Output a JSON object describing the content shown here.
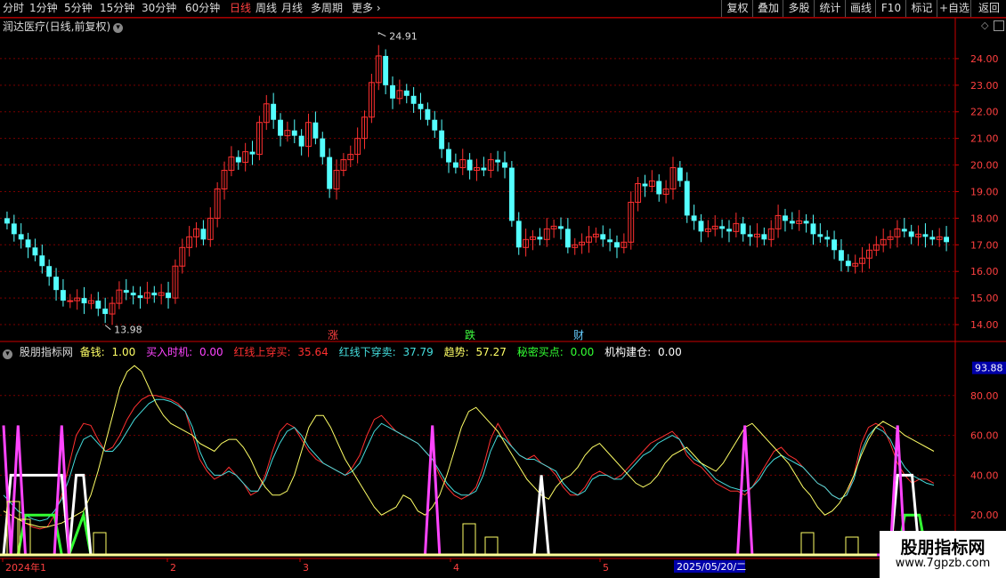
{
  "toolbar": {
    "periods": [
      "分时",
      "1分钟",
      "5分钟",
      "15分钟",
      "30分钟",
      "60分钟",
      "日线",
      "周线",
      "月线",
      "多周期",
      "更多"
    ],
    "active_period": "日线",
    "more_chevron": "›",
    "buttons": [
      "复权",
      "叠加",
      "多股",
      "统计",
      "画线",
      "F10",
      "标记",
      "+自选",
      "返回"
    ]
  },
  "main_chart": {
    "title": "润达医疗(日线,前复权)",
    "high_label": "24.91",
    "low_label": "13.98",
    "markers": [
      {
        "text": "涨",
        "color": "#ff4040"
      },
      {
        "text": "跌",
        "color": "#40ff40"
      },
      {
        "text": "财",
        "color": "#66ccff"
      }
    ]
  },
  "indicator": {
    "name": "股朋指标网",
    "items": [
      {
        "label": "备钱:",
        "value": "1.00",
        "color": "#ffff66"
      },
      {
        "label": "买入时机:",
        "value": "0.00",
        "color": "#ff44ff"
      },
      {
        "label": "红线上穿买:",
        "value": "35.64",
        "color": "#ff3030"
      },
      {
        "label": "红线下穿卖:",
        "value": "37.79",
        "color": "#44dddd"
      },
      {
        "label": "趋势:",
        "value": "57.27",
        "color": "#ffff66"
      },
      {
        "label": "秘密买点:",
        "value": "0.00",
        "color": "#33ff33"
      },
      {
        "label": "机构建仓:",
        "value": "0.00",
        "color": "#ffffff"
      }
    ],
    "current_value_tag": "93.88"
  },
  "timeline": {
    "labels": [
      "2024年1",
      "2",
      "3",
      "4",
      "5"
    ],
    "cursor_date": "2025/05/20/二"
  },
  "brand": {
    "title": "股朋指标网",
    "url": "www.7gpzb.com"
  },
  "colors": {
    "up": "#ff3030",
    "down": "#54ffff",
    "grid": "#7a0000",
    "axis": "#cc0000"
  },
  "chart_data": [
    {
      "type": "candlestick",
      "title": "润达医疗(日线,前复权)",
      "ylim": [
        13.5,
        25.0
      ],
      "y_ticks": [
        14.0,
        15.0,
        16.0,
        17.0,
        18.0,
        19.0,
        20.0,
        21.0,
        22.0,
        23.0,
        24.0
      ],
      "high": 24.91,
      "low": 13.98,
      "close": [
        17.8,
        17.4,
        17.2,
        16.9,
        16.6,
        16.2,
        15.8,
        15.3,
        14.9,
        14.9,
        15.0,
        14.8,
        14.9,
        14.6,
        14.4,
        14.8,
        15.3,
        15.2,
        15.1,
        15.0,
        15.2,
        15.1,
        15.2,
        15.0,
        16.2,
        16.9,
        17.3,
        17.6,
        17.2,
        18.0,
        19.1,
        19.8,
        20.3,
        20.1,
        20.5,
        20.4,
        21.6,
        22.3,
        21.7,
        21.1,
        21.3,
        21.1,
        20.7,
        21.6,
        21.0,
        20.3,
        19.1,
        19.8,
        20.2,
        20.4,
        21.0,
        21.8,
        23.1,
        24.1,
        23.0,
        22.5,
        22.8,
        22.6,
        22.3,
        22.1,
        21.7,
        21.3,
        20.6,
        20.1,
        19.9,
        20.2,
        19.8,
        19.9,
        19.8,
        20.2,
        20.1,
        19.9,
        17.9,
        16.9,
        17.2,
        17.3,
        17.2,
        17.6,
        17.7,
        17.6,
        16.9,
        17.0,
        17.1,
        17.3,
        17.4,
        17.2,
        17.1,
        16.9,
        17.1,
        18.6,
        19.3,
        19.2,
        19.4,
        18.9,
        19.1,
        19.9,
        19.4,
        18.1,
        17.9,
        17.5,
        17.6,
        17.7,
        17.6,
        17.5,
        17.8,
        17.4,
        17.3,
        17.4,
        17.2,
        17.6,
        18.1,
        17.9,
        17.8,
        17.9,
        17.8,
        17.4,
        17.3,
        17.2,
        16.8,
        16.4,
        16.2,
        16.3,
        16.5,
        16.8,
        17.0,
        17.2,
        17.3,
        17.6,
        17.5,
        17.3,
        17.4,
        17.3,
        17.2,
        17.3,
        17.1
      ],
      "volume_markers": [
        "涨",
        "跌",
        "财"
      ]
    },
    {
      "type": "line",
      "title": "股朋指标网",
      "ylim": [
        0,
        100
      ],
      "y_ticks": [
        20,
        40,
        60,
        80
      ],
      "series": [
        {
          "name": "红线上穿买",
          "color": "#ff3030",
          "values": [
            22,
            20,
            18,
            16,
            14,
            13,
            14,
            20,
            30,
            45,
            60,
            66,
            65,
            58,
            52,
            54,
            60,
            68,
            74,
            78,
            80,
            80,
            79,
            78,
            76,
            72,
            60,
            48,
            42,
            38,
            40,
            44,
            40,
            36,
            30,
            32,
            40,
            52,
            62,
            66,
            64,
            58,
            52,
            48,
            46,
            44,
            42,
            40,
            44,
            50,
            60,
            68,
            70,
            66,
            62,
            60,
            58,
            56,
            52,
            48,
            40,
            34,
            30,
            28,
            30,
            34,
            44,
            58,
            66,
            60,
            54,
            50,
            48,
            50,
            46,
            44,
            40,
            34,
            30,
            30,
            34,
            40,
            42,
            40,
            38,
            40,
            44,
            48,
            52,
            56,
            58,
            60,
            62,
            58,
            50,
            46,
            44,
            40,
            36,
            34,
            32,
            32,
            30,
            34,
            40,
            46,
            52,
            54,
            50,
            48,
            44,
            40,
            36,
            34,
            30,
            28,
            30,
            40,
            56,
            64,
            66,
            64,
            56,
            46,
            40,
            36,
            38,
            38,
            36
          ]
        },
        {
          "name": "红线下穿卖",
          "color": "#44dddd",
          "values": [
            30,
            26,
            22,
            20,
            18,
            17,
            18,
            22,
            28,
            38,
            50,
            58,
            60,
            56,
            52,
            52,
            56,
            62,
            68,
            72,
            76,
            78,
            78,
            77,
            75,
            72,
            64,
            52,
            44,
            40,
            40,
            42,
            40,
            36,
            32,
            32,
            38,
            48,
            56,
            62,
            64,
            60,
            54,
            50,
            46,
            44,
            42,
            40,
            42,
            46,
            54,
            62,
            66,
            64,
            62,
            60,
            58,
            56,
            52,
            48,
            42,
            36,
            32,
            30,
            30,
            32,
            40,
            52,
            60,
            58,
            54,
            50,
            48,
            48,
            46,
            44,
            42,
            36,
            32,
            30,
            32,
            38,
            40,
            40,
            38,
            38,
            42,
            46,
            50,
            52,
            56,
            58,
            60,
            58,
            52,
            48,
            46,
            42,
            38,
            36,
            34,
            33,
            32,
            34,
            38,
            44,
            48,
            50,
            48,
            46,
            44,
            40,
            36,
            34,
            30,
            28,
            30,
            38,
            52,
            60,
            64,
            62,
            58,
            50,
            44,
            40,
            38,
            36,
            35
          ]
        },
        {
          "name": "趋势",
          "color": "#ffff66",
          "values": [
            22,
            20,
            18,
            16,
            15,
            14,
            14,
            15,
            16,
            18,
            20,
            22,
            30,
            42,
            56,
            70,
            84,
            92,
            95,
            92,
            84,
            76,
            70,
            66,
            64,
            62,
            60,
            56,
            54,
            52,
            56,
            58,
            58,
            54,
            48,
            40,
            34,
            30,
            30,
            32,
            40,
            52,
            64,
            70,
            70,
            64,
            56,
            48,
            42,
            36,
            30,
            24,
            20,
            22,
            24,
            30,
            28,
            22,
            20,
            24,
            30,
            40,
            52,
            64,
            72,
            74,
            70,
            66,
            62,
            56,
            50,
            44,
            38,
            34,
            30,
            28,
            34,
            38,
            40,
            44,
            50,
            54,
            56,
            52,
            48,
            44,
            40,
            36,
            34,
            36,
            40,
            46,
            50,
            52,
            54,
            50,
            46,
            44,
            42,
            46,
            52,
            58,
            64,
            66,
            62,
            58,
            54,
            50,
            46,
            40,
            34,
            30,
            24,
            20,
            22,
            26,
            32,
            40,
            50,
            58,
            64,
            67,
            65,
            63,
            60,
            58,
            56,
            54,
            52
          ]
        },
        {
          "name": "秘密买点",
          "color": "#33ff33",
          "values": [
            0,
            0,
            0,
            20,
            20,
            20,
            20,
            20,
            0,
            0,
            10,
            20,
            0,
            0,
            0,
            0,
            0,
            0,
            0,
            0,
            0,
            0,
            0,
            0,
            0,
            0,
            0,
            0,
            0,
            0,
            0,
            0,
            0,
            0,
            0,
            0,
            0,
            0,
            0,
            0,
            0,
            0,
            0,
            0,
            0,
            0,
            0,
            0,
            0,
            0,
            0,
            0,
            0,
            0,
            0,
            0,
            0,
            0,
            0,
            0,
            0,
            0,
            0,
            0,
            0,
            0,
            0,
            0,
            0,
            0,
            0,
            0,
            0,
            0,
            0,
            0,
            0,
            0,
            0,
            0,
            0,
            0,
            0,
            0,
            0,
            0,
            0,
            0,
            0,
            0,
            0,
            0,
            0,
            0,
            0,
            0,
            0,
            0,
            0,
            0,
            0,
            0,
            0,
            0,
            0,
            0,
            0,
            0,
            0,
            0,
            0,
            0,
            0,
            0,
            0,
            0,
            0,
            0,
            0,
            0,
            0,
            0,
            0,
            0,
            20,
            20,
            20,
            0,
            0
          ]
        },
        {
          "name": "机构建仓",
          "color": "#ffffff",
          "values": [
            0,
            40,
            40,
            40,
            40,
            40,
            40,
            40,
            40,
            0,
            40,
            40,
            0,
            0,
            0,
            0,
            0,
            0,
            0,
            0,
            0,
            0,
            0,
            0,
            0,
            0,
            0,
            0,
            0,
            0,
            0,
            0,
            0,
            0,
            0,
            0,
            0,
            0,
            0,
            0,
            0,
            0,
            0,
            0,
            0,
            0,
            0,
            0,
            0,
            0,
            0,
            0,
            0,
            0,
            0,
            0,
            0,
            0,
            0,
            0,
            0,
            0,
            0,
            0,
            0,
            0,
            0,
            0,
            0,
            0,
            0,
            0,
            0,
            0,
            40,
            0,
            0,
            0,
            0,
            0,
            0,
            0,
            0,
            0,
            0,
            0,
            0,
            0,
            0,
            0,
            0,
            0,
            0,
            0,
            0,
            0,
            0,
            0,
            0,
            0,
            0,
            0,
            0,
            0,
            0,
            0,
            0,
            0,
            0,
            0,
            0,
            0,
            0,
            0,
            0,
            0,
            0,
            0,
            0,
            0,
            0,
            0,
            0,
            40,
            40,
            40,
            0,
            0,
            0
          ]
        },
        {
          "name": "买入时机",
          "color": "#ff44ff",
          "values": [
            65,
            0,
            65,
            0,
            0,
            0,
            0,
            0,
            65,
            0,
            0,
            0,
            0,
            0,
            0,
            0,
            0,
            0,
            0,
            0,
            0,
            0,
            0,
            0,
            0,
            0,
            0,
            0,
            0,
            0,
            0,
            0,
            0,
            0,
            0,
            0,
            0,
            0,
            0,
            0,
            0,
            0,
            0,
            0,
            0,
            0,
            0,
            0,
            0,
            0,
            0,
            0,
            0,
            0,
            0,
            0,
            0,
            0,
            0,
            65,
            0,
            0,
            0,
            0,
            0,
            0,
            0,
            0,
            0,
            0,
            0,
            0,
            0,
            0,
            0,
            0,
            0,
            0,
            0,
            0,
            0,
            0,
            0,
            0,
            0,
            0,
            0,
            0,
            0,
            0,
            0,
            0,
            0,
            0,
            0,
            0,
            0,
            0,
            0,
            0,
            0,
            0,
            65,
            0,
            0,
            0,
            0,
            0,
            0,
            0,
            0,
            0,
            0,
            0,
            0,
            0,
            0,
            0,
            0,
            0,
            0,
            0,
            0,
            65,
            0,
            0,
            0,
            0,
            0
          ]
        }
      ],
      "value_tag": 93.88
    }
  ]
}
